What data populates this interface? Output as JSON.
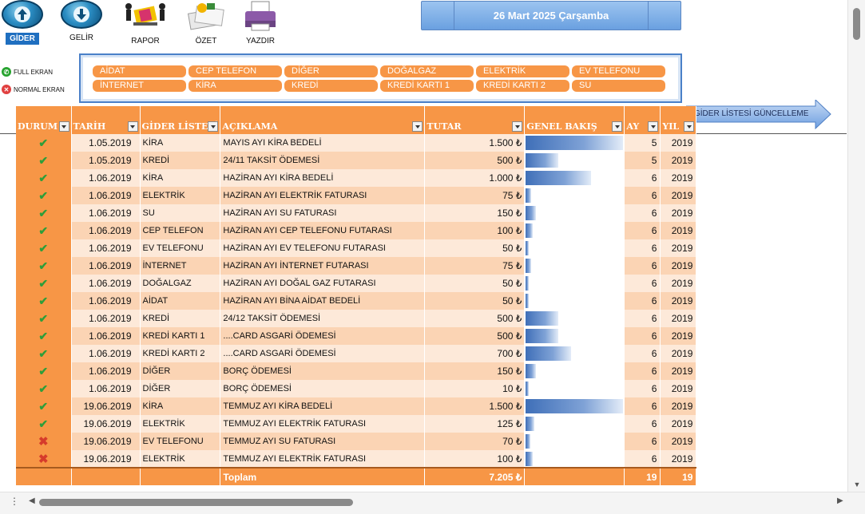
{
  "toolbar": {
    "gider_label": "GİDER",
    "gelir_label": "GELİR",
    "rapor_label": "RAPOR",
    "ozet_label": "ÖZET",
    "yazdir_label": "YAZDIR"
  },
  "date_display": "26 Mart 2025 Çarşamba",
  "screen_options": {
    "full_label": "FULL EKRAN",
    "normal_label": "NORMAL EKRAN"
  },
  "categories": [
    "AİDAT",
    "CEP TELEFON",
    "DİĞER",
    "DOĞALGAZ",
    "ELEKTRİK",
    "EV TELEFONU",
    "İNTERNET",
    "KİRA",
    "KREDİ",
    "KREDİ KARTI 1",
    "KREDİ KARTI 2",
    "SU"
  ],
  "update_button_label": "GİDER LİSTESİ GÜNCELLEME",
  "table": {
    "headers": [
      "DURUM",
      "TARİH",
      "GİDER LİSTESİ",
      "AÇIKLAMA",
      "TUTAR",
      "GENEL BAKIŞ",
      "AY",
      "YIL"
    ],
    "rows": [
      {
        "status": "ok",
        "date": "1.05.2019",
        "category": "KİRA",
        "desc": "MAYIS AYI KİRA BEDELİ",
        "amount": "1.500 ₺",
        "share": 1.0,
        "month": "5",
        "year": "2019"
      },
      {
        "status": "ok",
        "date": "1.05.2019",
        "category": "KREDİ",
        "desc": "24/11 TAKSİT ÖDEMESİ",
        "amount": "500 ₺",
        "share": 0.333,
        "month": "5",
        "year": "2019"
      },
      {
        "status": "ok",
        "date": "1.06.2019",
        "category": "KİRA",
        "desc": "HAZİRAN AYI KİRA BEDELİ",
        "amount": "1.000 ₺",
        "share": 0.667,
        "month": "6",
        "year": "2019"
      },
      {
        "status": "ok",
        "date": "1.06.2019",
        "category": "ELEKTRİK",
        "desc": "HAZİRAN AYI ELEKTRİK FATURASI",
        "amount": "75 ₺",
        "share": 0.05,
        "month": "6",
        "year": "2019"
      },
      {
        "status": "ok",
        "date": "1.06.2019",
        "category": "SU",
        "desc": "HAZİRAN AYI SU FATURASI",
        "amount": "150 ₺",
        "share": 0.1,
        "month": "6",
        "year": "2019"
      },
      {
        "status": "ok",
        "date": "1.06.2019",
        "category": "CEP TELEFON",
        "desc": "HAZİRAN AYI CEP TELEFONU FUTARASI",
        "amount": "100 ₺",
        "share": 0.067,
        "month": "6",
        "year": "2019"
      },
      {
        "status": "ok",
        "date": "1.06.2019",
        "category": "EV TELEFONU",
        "desc": "HAZİRAN AYI EV TELEFONU FUTARASI",
        "amount": "50 ₺",
        "share": 0.033,
        "month": "6",
        "year": "2019"
      },
      {
        "status": "ok",
        "date": "1.06.2019",
        "category": "İNTERNET",
        "desc": "HAZİRAN AYI İNTERNET FUTARASI",
        "amount": "75 ₺",
        "share": 0.05,
        "month": "6",
        "year": "2019"
      },
      {
        "status": "ok",
        "date": "1.06.2019",
        "category": "DOĞALGAZ",
        "desc": "HAZİRAN AYI DOĞAL GAZ FUTARASI",
        "amount": "50 ₺",
        "share": 0.033,
        "month": "6",
        "year": "2019"
      },
      {
        "status": "ok",
        "date": "1.06.2019",
        "category": "AİDAT",
        "desc": "HAZİRAN AYI BİNA AİDAT BEDELİ",
        "amount": "50 ₺",
        "share": 0.033,
        "month": "6",
        "year": "2019"
      },
      {
        "status": "ok",
        "date": "1.06.2019",
        "category": "KREDİ",
        "desc": "24/12 TAKSİT ÖDEMESİ",
        "amount": "500 ₺",
        "share": 0.333,
        "month": "6",
        "year": "2019"
      },
      {
        "status": "ok",
        "date": "1.06.2019",
        "category": "KREDİ KARTI 1",
        "desc": "....CARD ASGARİ ÖDEMESİ",
        "amount": "500 ₺",
        "share": 0.333,
        "month": "6",
        "year": "2019"
      },
      {
        "status": "ok",
        "date": "1.06.2019",
        "category": "KREDİ KARTI 2",
        "desc": "....CARD ASGARİ ÖDEMESİ",
        "amount": "700 ₺",
        "share": 0.467,
        "month": "6",
        "year": "2019"
      },
      {
        "status": "ok",
        "date": "1.06.2019",
        "category": "DİĞER",
        "desc": "BORÇ ÖDEMESİ",
        "amount": "150 ₺",
        "share": 0.1,
        "month": "6",
        "year": "2019"
      },
      {
        "status": "ok",
        "date": "1.06.2019",
        "category": "DİĞER",
        "desc": "BORÇ ÖDEMESİ",
        "amount": "10 ₺",
        "share": 0.007,
        "month": "6",
        "year": "2019"
      },
      {
        "status": "ok",
        "date": "19.06.2019",
        "category": "KİRA",
        "desc": "TEMMUZ AYI KİRA BEDELİ",
        "amount": "1.500 ₺",
        "share": 1.0,
        "month": "6",
        "year": "2019"
      },
      {
        "status": "ok",
        "date": "19.06.2019",
        "category": "ELEKTRİK",
        "desc": "TEMMUZ AYI ELEKTRİK FATURASI",
        "amount": "125 ₺",
        "share": 0.083,
        "month": "6",
        "year": "2019"
      },
      {
        "status": "x",
        "date": "19.06.2019",
        "category": "EV TELEFONU",
        "desc": "TEMMUZ AYI SU FATURASI",
        "amount": "70 ₺",
        "share": 0.047,
        "month": "6",
        "year": "2019"
      },
      {
        "status": "x",
        "date": "19.06.2019",
        "category": "ELEKTRİK",
        "desc": "TEMMUZ AYI ELEKTRİK FATURASI",
        "amount": "100 ₺",
        "share": 0.067,
        "month": "6",
        "year": "2019"
      }
    ],
    "total": {
      "label": "Toplam",
      "amount": "7.205 ₺",
      "month": "19",
      "year": "19"
    }
  }
}
